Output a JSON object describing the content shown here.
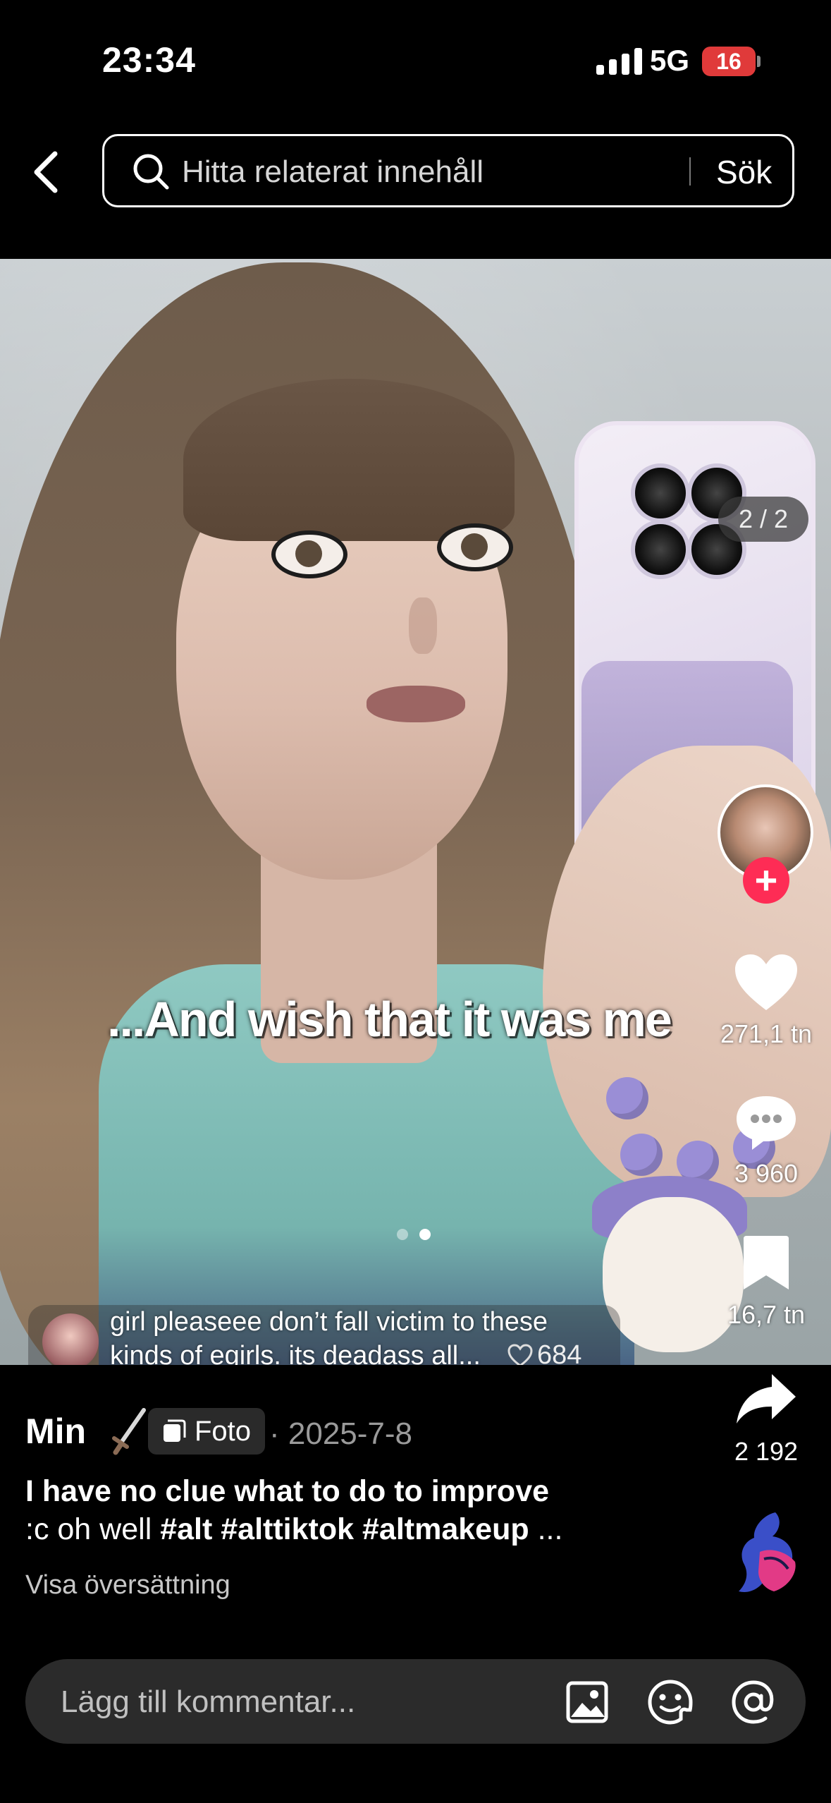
{
  "status_bar": {
    "time": "23:34",
    "network": "5G",
    "battery": "16"
  },
  "search": {
    "placeholder": "Hitta relaterat innehåll",
    "button": "Sök"
  },
  "media": {
    "counter": "2 / 2",
    "caption": "...And wish that it was me"
  },
  "featured_comment": {
    "text": "girl pleaseee don’t fall victim to these kinds of egirls. its deadass all...",
    "likes": "684"
  },
  "actions": {
    "likes": "271,1 tn",
    "comments": "3 960",
    "saves": "16,7 tn",
    "shares": "2 192"
  },
  "post": {
    "author": "Min",
    "type_badge": "Foto",
    "date": "· 2025-7-8",
    "description_line1": "I have no clue what to do to improve",
    "description_prefix": ":c oh well",
    "hashtags": [
      "#alt",
      "#alttiktok",
      "#altmakeup"
    ],
    "ellipsis": "...",
    "translate": "Visa översättning"
  },
  "comment_input": {
    "placeholder": "Lägg till kommentar..."
  }
}
